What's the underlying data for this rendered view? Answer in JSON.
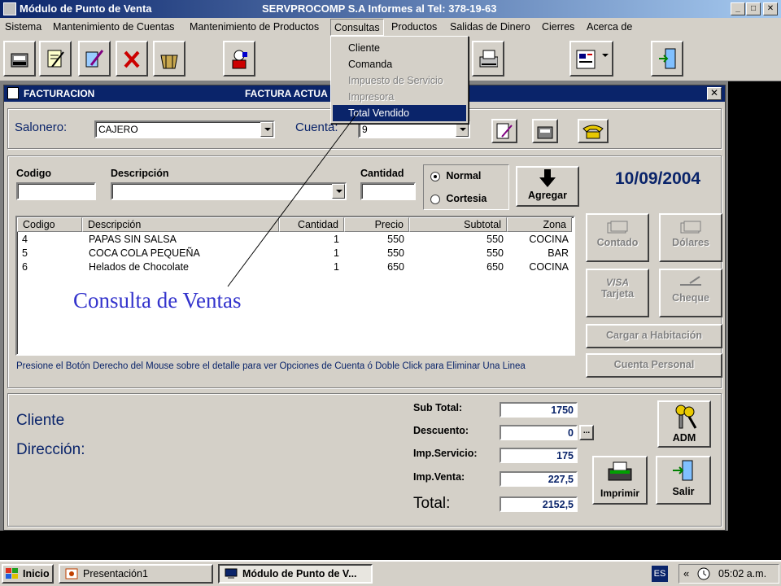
{
  "app": {
    "title_left": "Módulo de Punto de Venta",
    "title_right": "SERVPROCOMP S.A  Informes al Tel:  378-19-63",
    "min": "_",
    "max": "□",
    "close": "✕"
  },
  "menu": [
    "Sistema",
    "Mantenimiento de Cuentas",
    "Mantenimiento de Productos",
    "Consultas",
    "Productos",
    "Salidas de Dinero",
    "Cierres",
    "Acerca de"
  ],
  "consultas_menu": [
    {
      "label": "Cliente",
      "state": "enabled"
    },
    {
      "label": "Comanda",
      "state": "enabled"
    },
    {
      "label": "Impuesto de Servicio",
      "state": "disabled"
    },
    {
      "label": "Impresora",
      "state": "disabled"
    },
    {
      "label": "Total Vendido",
      "state": "selected"
    }
  ],
  "form": {
    "title_left": "FACTURACION",
    "title_right": "FACTURA ACTUA",
    "close": "✕",
    "salonero_label": "Salonero:",
    "salonero_value": "CAJERO",
    "cuenta_label": "Cuenta:",
    "cuenta_value": "9",
    "codigo_label": "Codigo",
    "descripcion_label": "Descripción",
    "cantidad_label": "Cantidad",
    "radio_normal": "Normal",
    "radio_cortesia": "Cortesia",
    "agregar": "Agregar",
    "date": "10/09/2004",
    "hint": "Presione el Botón Derecho del Mouse sobre el detalle para ver Opciones de Cuenta ó Doble Click para Eliminar Una Linea"
  },
  "grid": {
    "headers": [
      "Codigo",
      "Descripción",
      "Cantidad",
      "Precio",
      "Subtotal",
      "Zona"
    ],
    "rows": [
      [
        "4",
        "PAPAS SIN SALSA",
        "1",
        "550",
        "550",
        "COCINA"
      ],
      [
        "5",
        "COCA COLA PEQUEÑA",
        "1",
        "550",
        "550",
        "BAR"
      ],
      [
        "6",
        "Helados de Chocolate",
        "1",
        "650",
        "650",
        "COCINA"
      ]
    ]
  },
  "payments": {
    "contado": "Contado",
    "dolares": "Dólares",
    "tarjeta": "Tarjeta",
    "tarjeta_icon_text": "VISA",
    "cheque": "Cheque",
    "cargar": "Cargar a Habitación",
    "cuenta_personal": "Cuenta Personal"
  },
  "bottom": {
    "cliente_label": "Cliente",
    "direccion_label": "Dirección:",
    "subtotal_label": "Sub Total:",
    "subtotal": "1750",
    "descuento_label": "Descuento:",
    "descuento": "0",
    "descuento_btn": "...",
    "impserv_label": "Imp.Servicio:",
    "impserv": "175",
    "impventa_label": "Imp.Venta:",
    "impventa": "227,5",
    "total_label": "Total:",
    "total": "2152,5",
    "adm": "ADM",
    "imprimir": "Imprimir",
    "salir": "Salir"
  },
  "annotation": "Consulta  de Ventas",
  "taskbar": {
    "start": "Inicio",
    "tasks": [
      "Presentación1",
      "Módulo de Punto de V..."
    ],
    "lang": "ES",
    "chevron": "«",
    "clock": "05:02 a.m."
  },
  "colors": {
    "title_blue": "#0a246a",
    "face": "#d4d0c8",
    "annotation_blue": "#3333cc"
  }
}
